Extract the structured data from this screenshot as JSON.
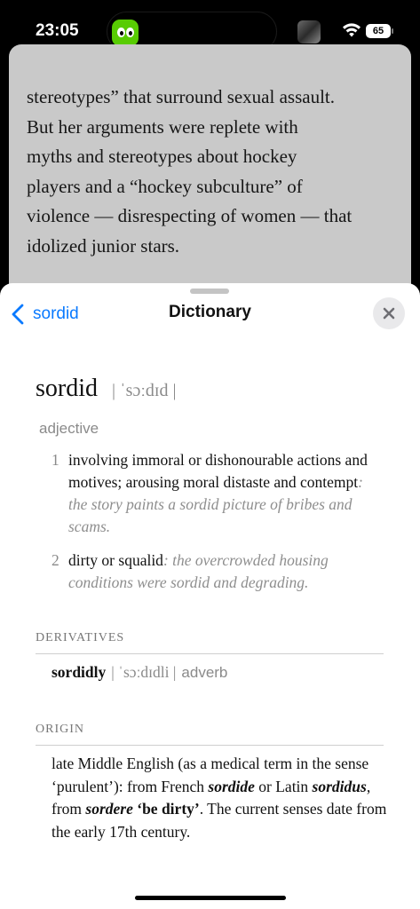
{
  "status": {
    "time": "23:05",
    "battery": "65"
  },
  "article": {
    "lines": [
      "stereotypes” that surround sexual assault.",
      "But her arguments were replete with",
      "myths and stereotypes about hockey",
      "players and a “hockey subculture” of",
      "violence — disrespecting of women — that",
      "idolized junior stars."
    ]
  },
  "header": {
    "back_label": "sordid",
    "title": "Dictionary"
  },
  "entry": {
    "word": "sordid",
    "pronunciation": "| ˈsɔːdɪd |",
    "part_of_speech": "adjective",
    "senses": [
      {
        "number": "1",
        "definition": "involving immoral or dishonourable actions and motives; arousing moral distaste and contempt",
        "example": "the story paints a sordid picture of bribes and scams."
      },
      {
        "number": "2",
        "definition": "dirty or squalid",
        "example": "the overcrowded housing conditions were sordid and degrading."
      }
    ]
  },
  "derivatives": {
    "label": "DERIVATIVES",
    "word": "sordidly",
    "pronunciation": "| ˈsɔːdɪdli |",
    "pos": "adverb"
  },
  "origin": {
    "label": "ORIGIN",
    "t1": "late Middle English (as a medical term in the sense ‘purulent’): from French ",
    "w1": "sordide",
    "t2": " or Latin ",
    "w2": "sordidus",
    "t3": ", from ",
    "w3": "sordere",
    "t4": " ",
    "w4": "‘be dirty’",
    "t5": ". The current senses date from the early 17th century."
  },
  "colors": {
    "accent": "#0a7aff",
    "muted": "#8a8a8a",
    "app_icon": "#58cc02"
  }
}
